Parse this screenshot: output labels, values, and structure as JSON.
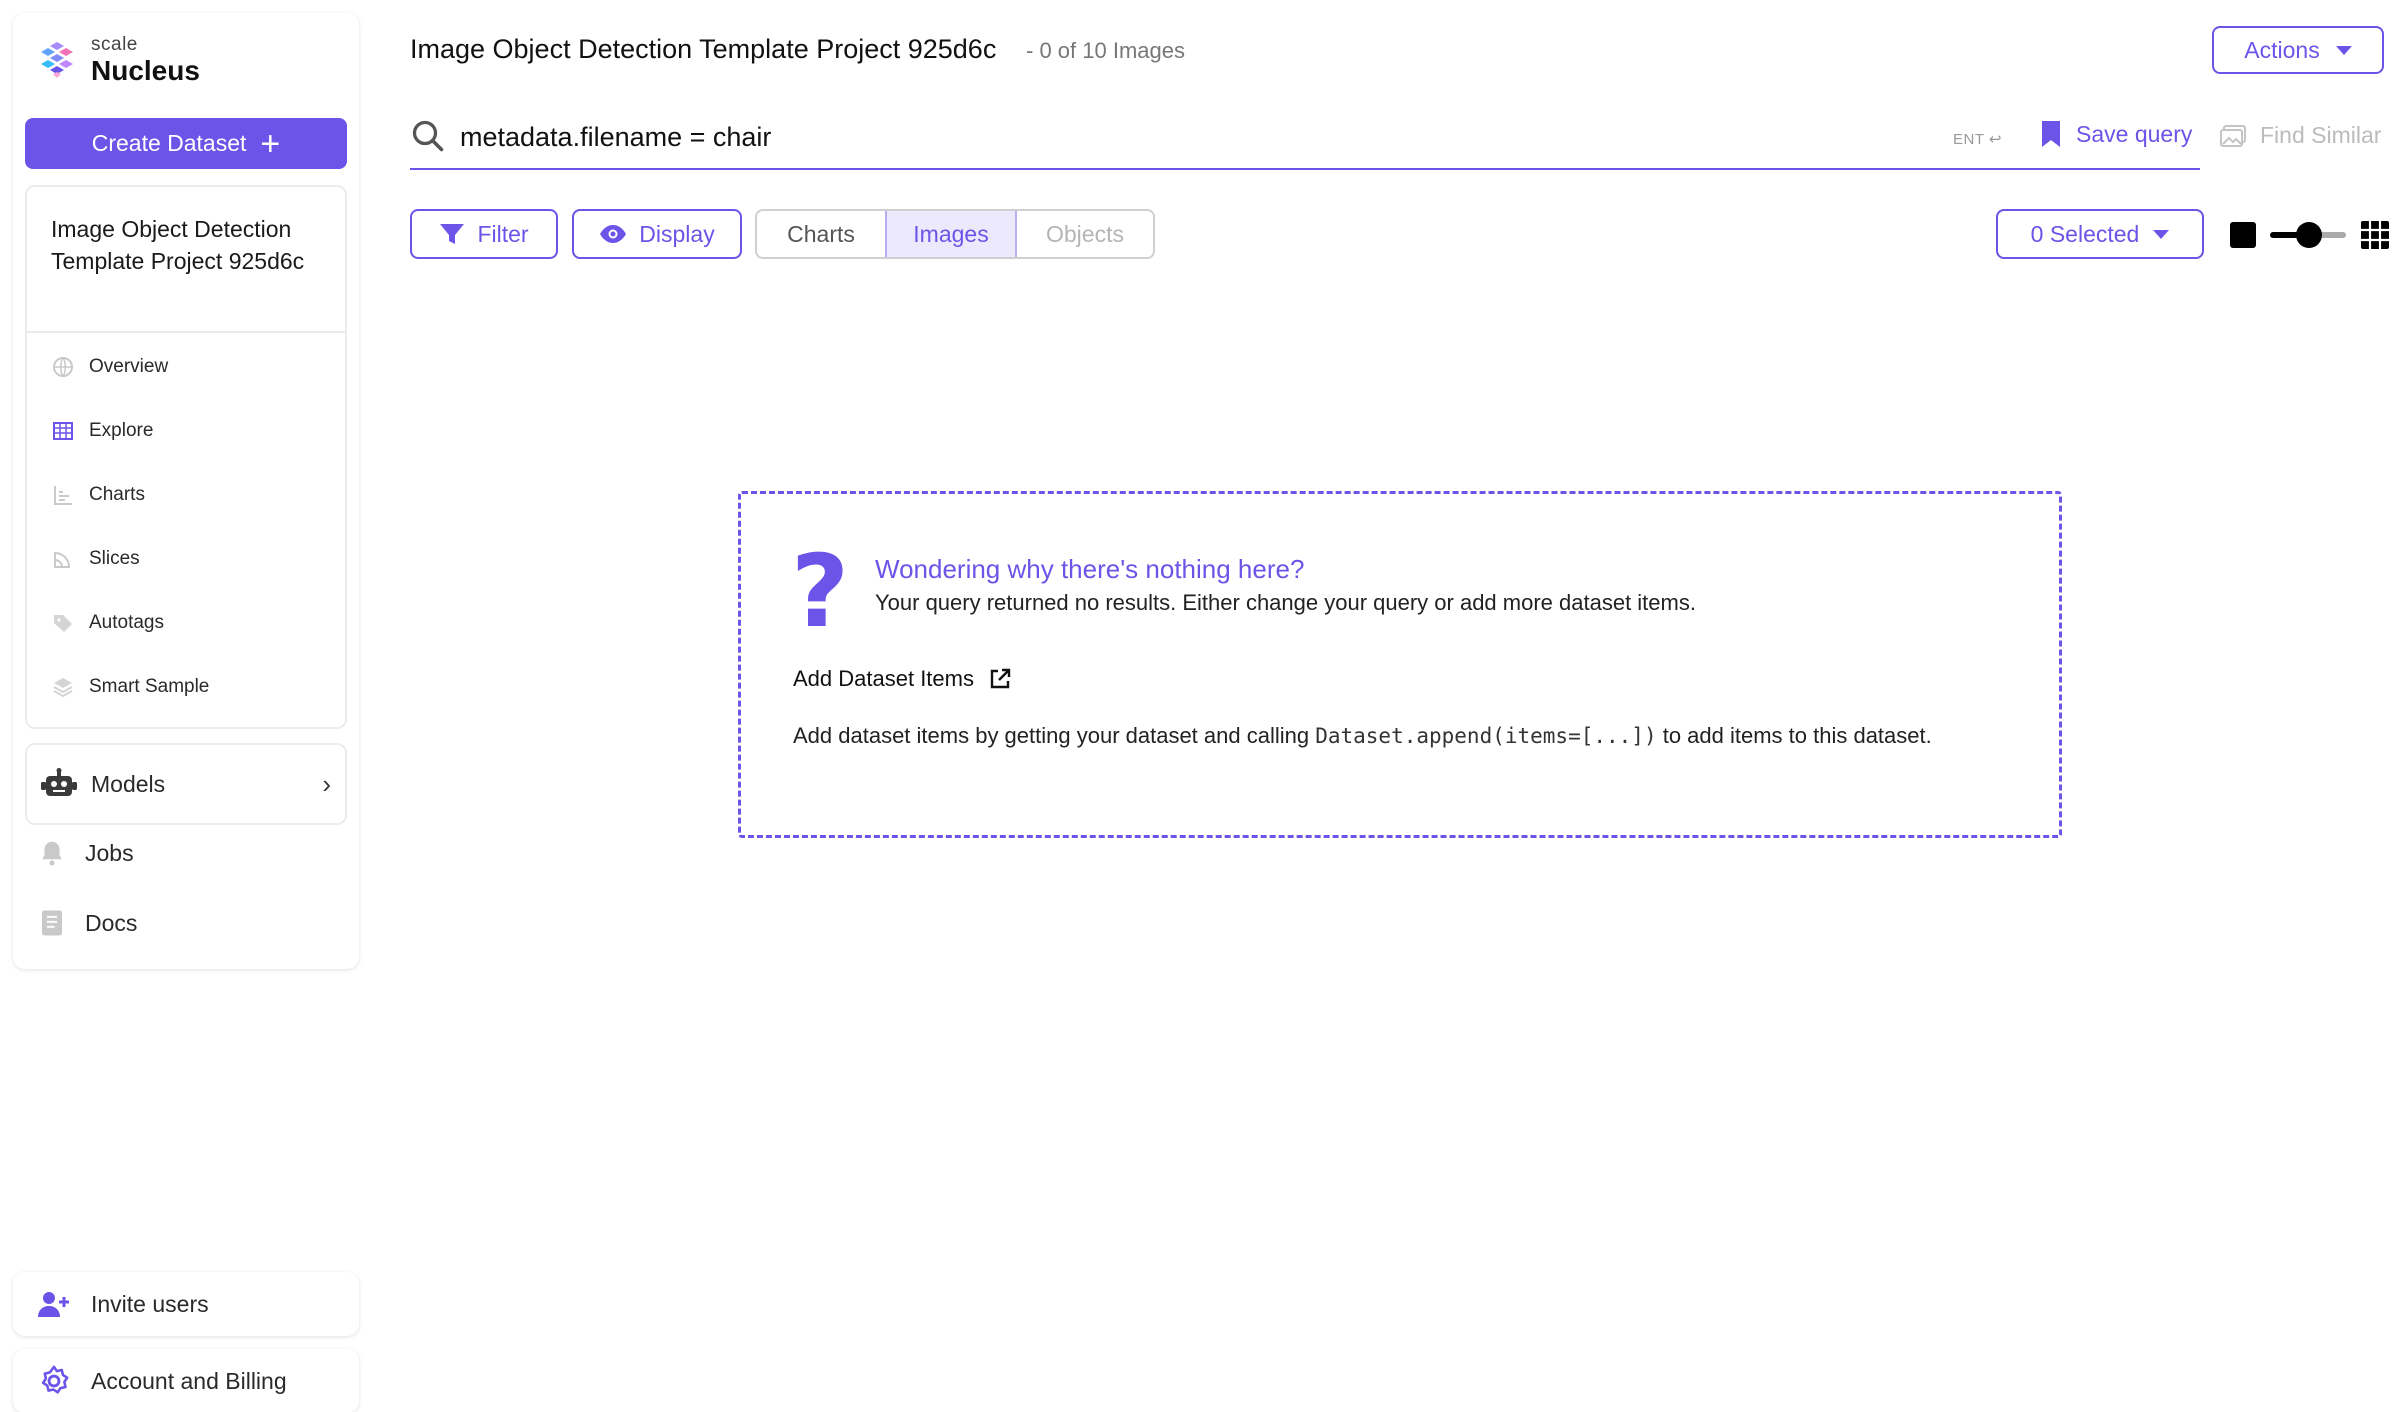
{
  "app": {
    "brand_small": "scale",
    "brand_name": "Nucleus"
  },
  "sidebar": {
    "create_dataset_label": "Create Dataset",
    "dataset_title": "Image Object Detection Template Project 925d6c",
    "items": [
      {
        "label": "Overview",
        "icon": "globe-icon"
      },
      {
        "label": "Explore",
        "icon": "grid-icon"
      },
      {
        "label": "Charts",
        "icon": "bar-chart-icon"
      },
      {
        "label": "Slices",
        "icon": "slices-icon"
      },
      {
        "label": "Autotags",
        "icon": "tag-icon"
      },
      {
        "label": "Smart Sample",
        "icon": "layers-icon"
      }
    ],
    "models_label": "Models",
    "jobs_label": "Jobs",
    "docs_label": "Docs",
    "invite_label": "Invite users",
    "account_label": "Account and Billing"
  },
  "header": {
    "title": "Image Object Detection Template Project 925d6c",
    "count": "- 0 of 10 Images",
    "actions_label": "Actions"
  },
  "search": {
    "query": "metadata.filename = chair",
    "enter_hint": "ENT ↩",
    "save_query_label": "Save query",
    "find_similar_label": "Find Similar"
  },
  "toolbar": {
    "filter_label": "Filter",
    "display_label": "Display",
    "tabs": [
      "Charts",
      "Images",
      "Objects"
    ],
    "active_tab": "Images",
    "selected_label": "0 Selected"
  },
  "empty_state": {
    "heading": "Wondering why there's nothing here?",
    "subtext": "Your query returned no results. Either change your query or add more dataset items.",
    "link_label": "Add Dataset Items",
    "desc_before": "Add dataset items by getting your dataset and calling ",
    "desc_code": "Dataset.append(items=[...])",
    "desc_after": " to add items to this dataset."
  },
  "colors": {
    "accent": "#6c54e8",
    "accent_light": "#ede9fd"
  }
}
